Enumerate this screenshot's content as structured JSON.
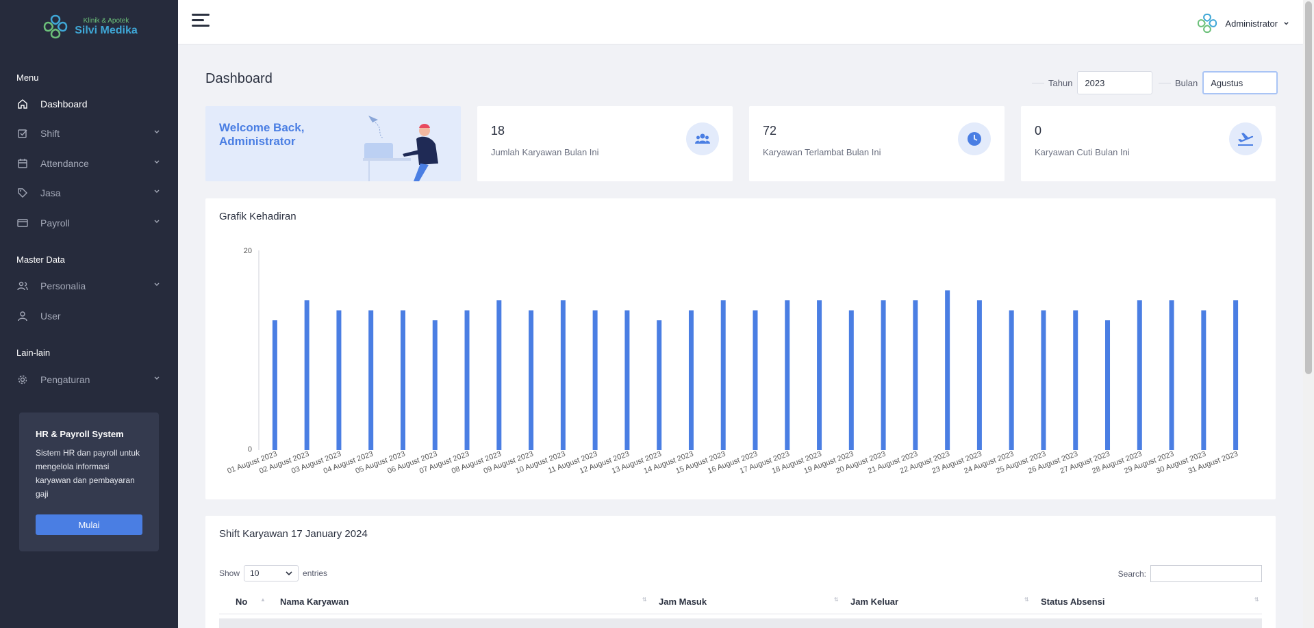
{
  "brand": {
    "sub": "Klinik & Apotek",
    "name": "Silvi Medika"
  },
  "sidebar": {
    "sections": [
      "Menu",
      "Master Data",
      "Lain-lain"
    ],
    "items": [
      {
        "label": "Dashboard",
        "icon": "home-icon",
        "active": true
      },
      {
        "label": "Shift",
        "icon": "checkbox-icon"
      },
      {
        "label": "Attendance",
        "icon": "calendar-icon"
      },
      {
        "label": "Jasa",
        "icon": "tag-icon"
      },
      {
        "label": "Payroll",
        "icon": "credit-card-icon"
      },
      {
        "label": "Personalia",
        "icon": "users-icon"
      },
      {
        "label": "User",
        "icon": "user-icon"
      },
      {
        "label": "Pengaturan",
        "icon": "gear-icon"
      }
    ],
    "promo": {
      "title": "HR & Payroll System",
      "text": "Sistem HR dan payroll untuk mengelola informasi karyawan dan pembayaran gaji",
      "button": "Mulai"
    }
  },
  "topbar": {
    "user": "Administrator"
  },
  "page": {
    "title": "Dashboard"
  },
  "filters": {
    "tahun_label": "Tahun",
    "tahun_value": "2023",
    "bulan_label": "Bulan",
    "bulan_value": "Agustus"
  },
  "welcome": {
    "line1": "Welcome Back,",
    "line2": "Administrator"
  },
  "stats": [
    {
      "value": "18",
      "label": "Jumlah Karyawan Bulan Ini",
      "icon": "users-icon"
    },
    {
      "value": "72",
      "label": "Karyawan Terlambat Bulan Ini",
      "icon": "clock-icon"
    },
    {
      "value": "0",
      "label": "Karyawan Cuti Bulan Ini",
      "icon": "airplane-icon"
    }
  ],
  "chart_title": "Grafik Kehadiran",
  "chart_data": {
    "type": "bar",
    "title": "Grafik Kehadiran",
    "ylim": [
      0,
      20
    ],
    "yticks": [
      "0",
      "20"
    ],
    "color": "#4a7ee3",
    "categories": [
      "01 August 2023",
      "02 August 2023",
      "03 August 2023",
      "04 August 2023",
      "05 August 2023",
      "06 August 2023",
      "07 August 2023",
      "08 August 2023",
      "09 August 2023",
      "10 August 2023",
      "11 August 2023",
      "12 August 2023",
      "13 August 2023",
      "14 August 2023",
      "15 August 2023",
      "16 August 2023",
      "17 August 2023",
      "18 August 2023",
      "19 August 2023",
      "20 August 2023",
      "21 August 2023",
      "22 August 2023",
      "23 August 2023",
      "24 August 2023",
      "25 August 2023",
      "26 August 2023",
      "27 August 2023",
      "28 August 2023",
      "29 August 2023",
      "30 August 2023",
      "31 August 2023"
    ],
    "values": [
      13,
      15,
      14,
      14,
      14,
      13,
      14,
      15,
      14,
      15,
      14,
      14,
      13,
      14,
      15,
      14,
      15,
      15,
      14,
      15,
      15,
      16,
      15,
      14,
      14,
      14,
      13,
      15,
      15,
      14,
      15
    ]
  },
  "table": {
    "title": "Shift Karyawan 17 January 2024",
    "show_label": "Show",
    "entries_value": "10",
    "entries_label": "entries",
    "search_label": "Search:",
    "columns": [
      "No",
      "Nama Karyawan",
      "Jam Masuk",
      "Jam Keluar",
      "Status Absensi"
    ]
  }
}
